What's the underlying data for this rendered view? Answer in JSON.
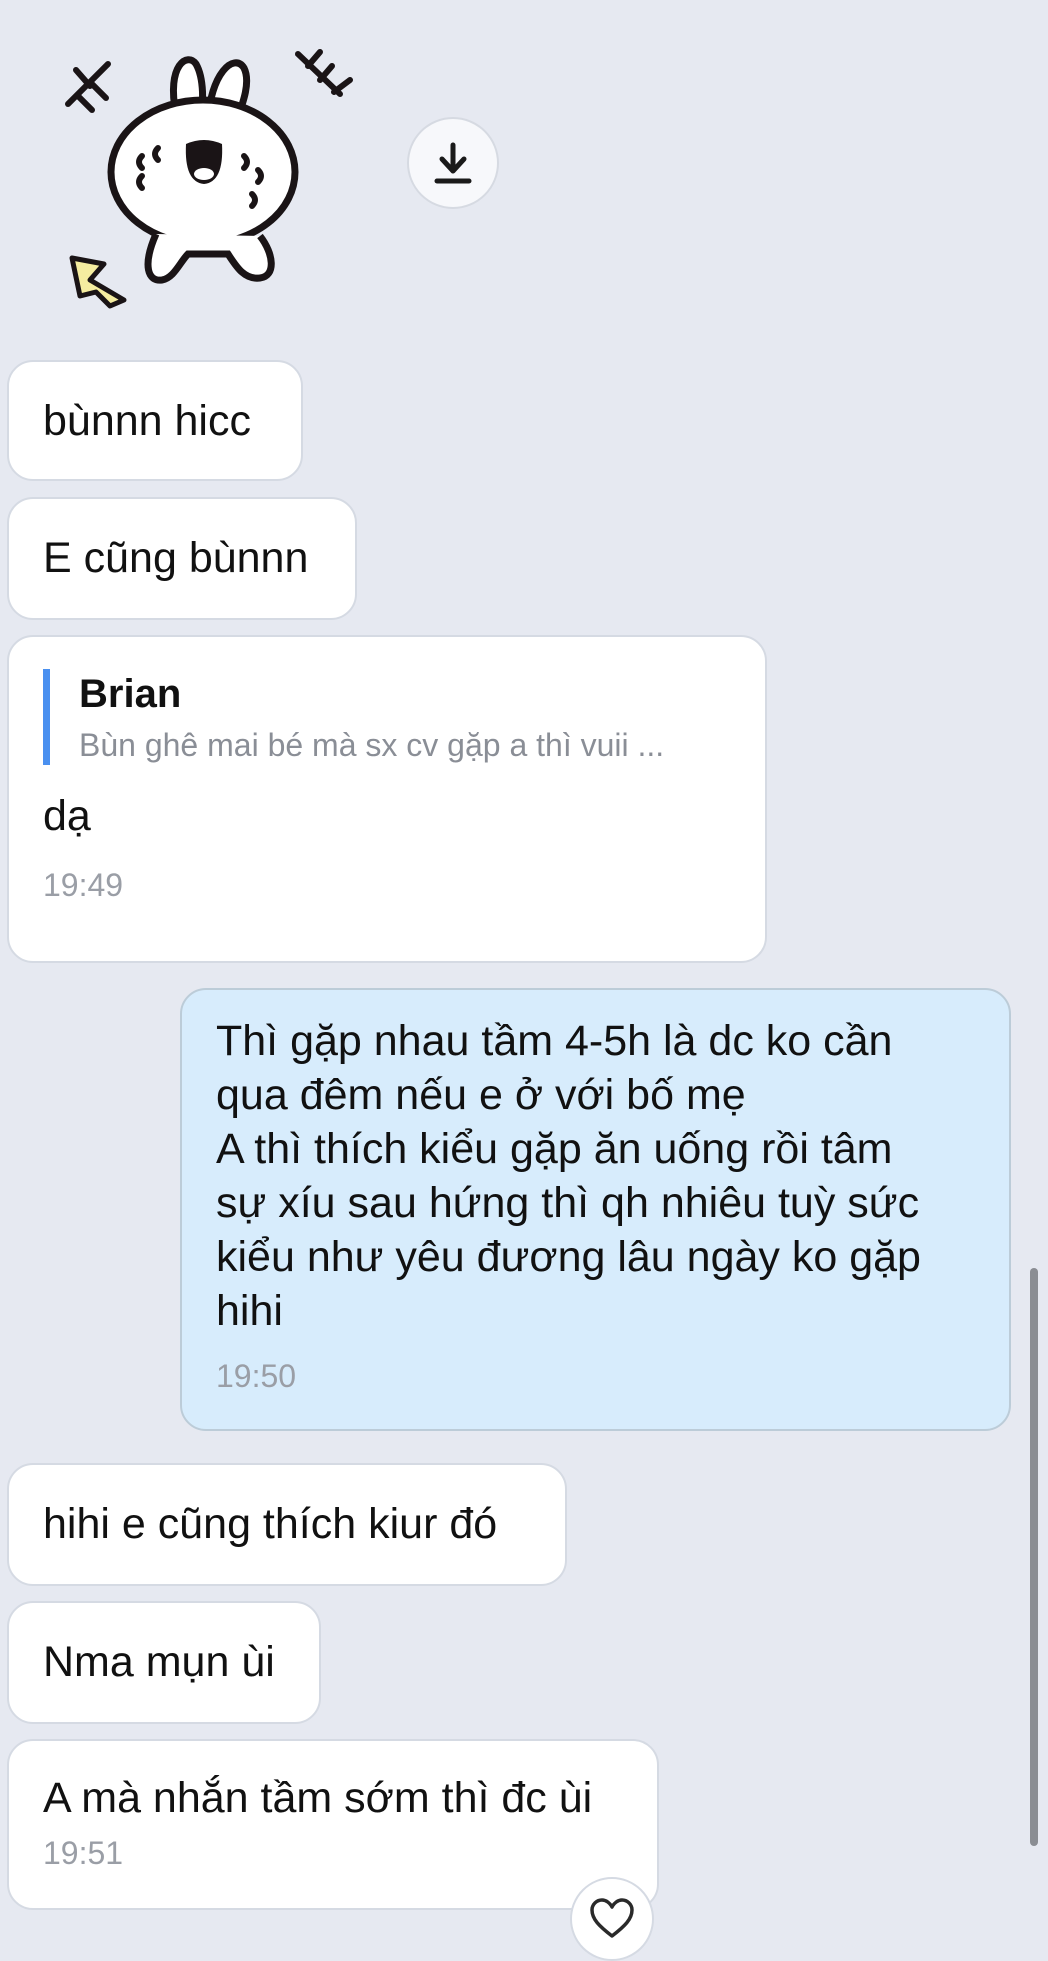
{
  "messages": [
    {
      "id": "m1",
      "type": "received",
      "text": "bùnnn hicc"
    },
    {
      "id": "m2",
      "type": "received",
      "text": "E cũng bùnnn"
    },
    {
      "id": "m3",
      "type": "received",
      "reply_to": {
        "name": "Brian",
        "text": "Bùn ghê mai bé mà sx cv gặp a thì vuii ..."
      },
      "text": "dạ",
      "time": "19:49"
    },
    {
      "id": "m4",
      "type": "sent",
      "text": "Thì gặp nhau tầm 4-5h là dc ko cần\nqua đêm nếu e ở với bố mẹ\nA thì thích kiểu gặp ăn uống rồi tâm\nsự xíu sau hứng thì qh nhiêu tuỳ sức\nkiểu như yêu đương lâu ngày ko gặp\nhihi",
      "time": "19:50"
    },
    {
      "id": "m5",
      "type": "received",
      "text": "hihi e cũng thích kiur đó"
    },
    {
      "id": "m6",
      "type": "received",
      "text": "Nma mụn ùi"
    },
    {
      "id": "m7",
      "type": "received",
      "text": "A mà nhắn tầm sớm thì đc ùi",
      "time": "19:51"
    }
  ],
  "icons": {
    "sticker": "bunny-sticker",
    "download": "download-icon",
    "reaction": "heart-icon"
  },
  "colors": {
    "background": "#e6e9f1",
    "received_bubble": "#ffffff",
    "sent_bubble": "#d7ecfc",
    "quote_bar": "#4a90f0",
    "time_text": "#9a9ea6"
  }
}
